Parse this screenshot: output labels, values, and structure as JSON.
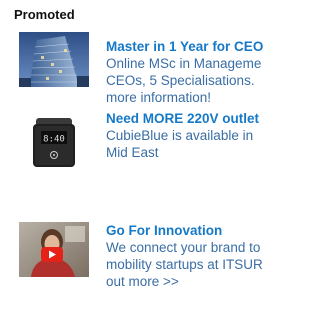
{
  "heading": "Promoted",
  "ads": [
    {
      "image": "office-building-photo",
      "title": "Master in 1 Year for CEO",
      "lines": [
        "Online MSc in Manageme",
        "CEOs, 5 Specialisations.",
        "more information!"
      ]
    },
    {
      "image": "cube-clock-speaker-photo",
      "title": "Need MORE 220V outlet",
      "lines": [
        "CubieBlue is available in",
        "Mid East"
      ]
    },
    {
      "image": "video-play-thumbnail",
      "title": "Go For Innovation",
      "lines": [
        "We connect your brand to",
        "mobility startups at ITSUR",
        "out more >>"
      ]
    }
  ],
  "colors": {
    "title": "#1679c8",
    "description": "#3a6ea5",
    "heading": "#111111",
    "play_button": "#e62117"
  }
}
